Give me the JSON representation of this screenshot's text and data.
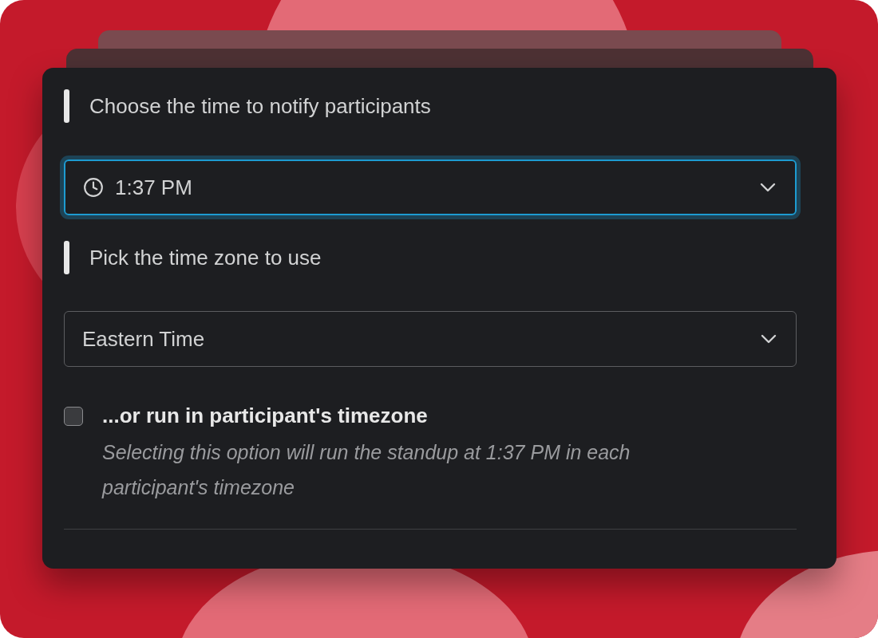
{
  "fields": [
    {
      "label": "Choose the time to notify participants",
      "kind": "time",
      "value": "1:37 PM",
      "focused": true
    },
    {
      "label": "Pick the time zone to use",
      "kind": "plain",
      "value": "Eastern Time",
      "focused": false
    }
  ],
  "option": {
    "checked": false,
    "title": "...or run in participant's timezone",
    "description": "Selecting this option will run the standup at 1:37 PM in each participant's timezone"
  }
}
